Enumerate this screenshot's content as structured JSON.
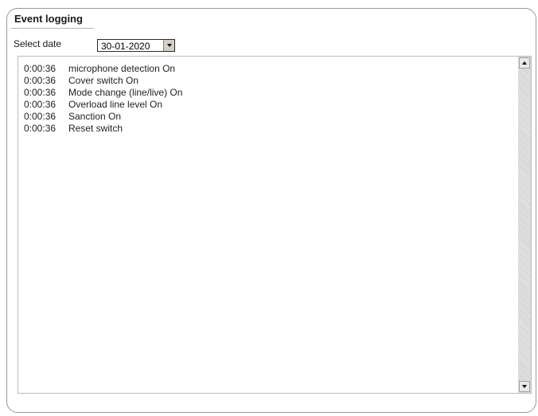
{
  "panel": {
    "title": "Event logging"
  },
  "date_filter": {
    "label": "Select date",
    "selected": "30-01-2020"
  },
  "events": [
    {
      "time": "0:00:36",
      "message": "microphone detection On"
    },
    {
      "time": "0:00:36",
      "message": "Cover switch On"
    },
    {
      "time": "0:00:36",
      "message": "Mode change (line/live) On"
    },
    {
      "time": "0:00:36",
      "message": "Overload line level On"
    },
    {
      "time": "0:00:36",
      "message": "Sanction On"
    },
    {
      "time": "0:00:36",
      "message": "Reset switch"
    }
  ],
  "icons": {
    "dropdown": "chevron-down-icon",
    "scroll_up": "scroll-up-arrow-icon",
    "scroll_down": "scroll-down-arrow-icon"
  }
}
